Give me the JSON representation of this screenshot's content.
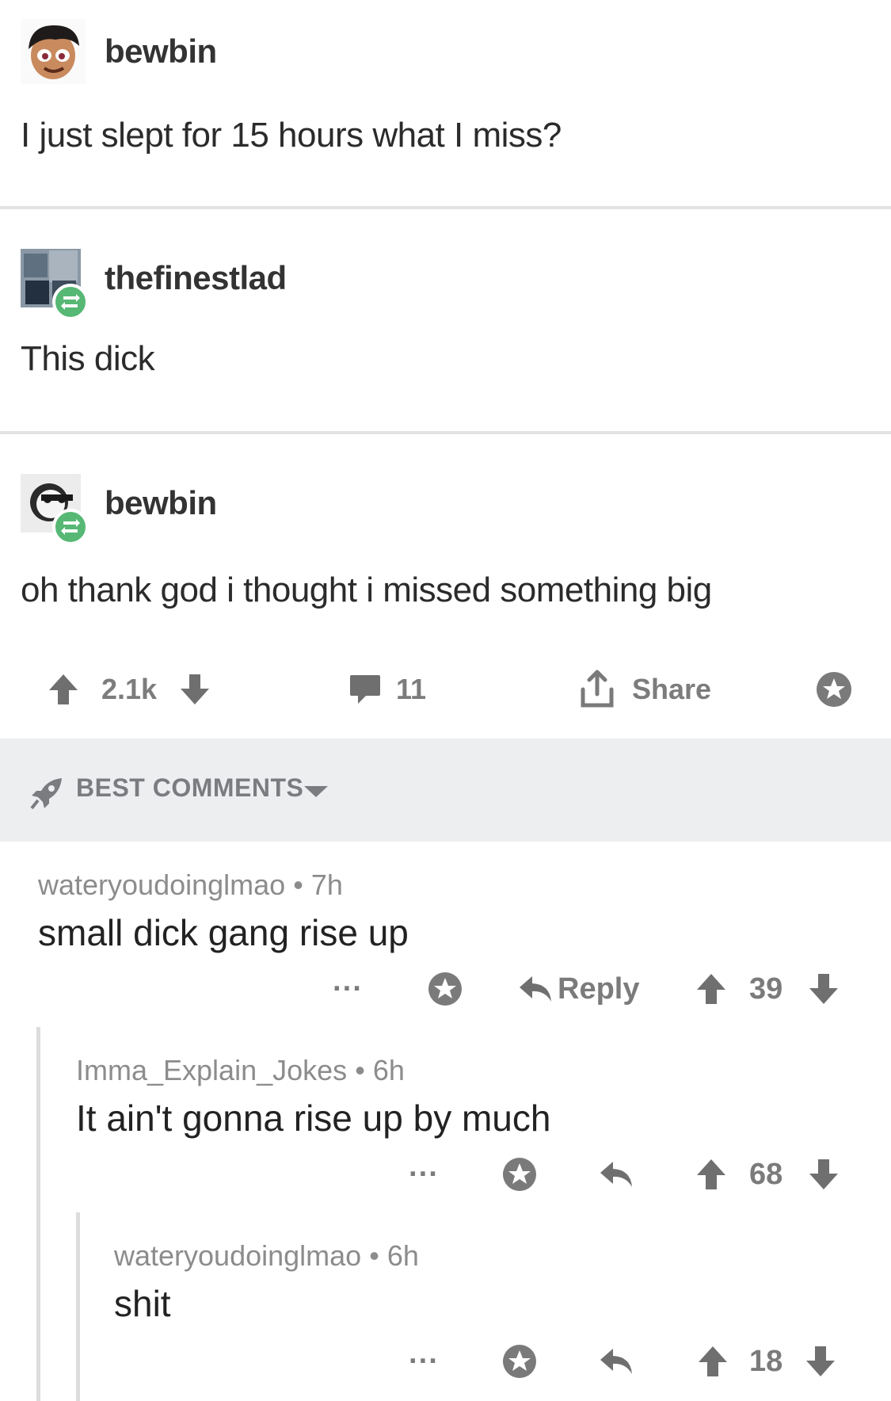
{
  "posts": [
    {
      "username": "bewbin",
      "text": "I just slept for 15 hours what I miss?"
    },
    {
      "username": "thefinestlad",
      "text": "This dick"
    },
    {
      "username": "bewbin",
      "text": "oh thank god i thought i missed something big"
    }
  ],
  "actions": {
    "upvotes": "2.1k",
    "comments": "11",
    "share_label": "Share"
  },
  "comments_header": {
    "label": "BEST COMMENTS"
  },
  "comments": [
    {
      "author": "wateryoudoinglmao",
      "sep": "•",
      "age": "7h",
      "body": "small dick gang rise up",
      "reply_label": "Reply",
      "score": "39",
      "more": "···"
    },
    {
      "author": "Imma_Explain_Jokes",
      "sep": "•",
      "age": "6h",
      "body": "It ain't gonna rise up by much",
      "score": "68",
      "more": "···"
    },
    {
      "author": "wateryoudoinglmao",
      "sep": "•",
      "age": "6h",
      "body": "shit",
      "score": "18",
      "more": "···"
    }
  ],
  "icons": {
    "upvote": "arrow-up-icon",
    "downvote": "arrow-down-icon",
    "comment": "speech-bubble-icon",
    "share": "share-icon",
    "save": "star-icon",
    "reply": "reply-arrow-icon",
    "sort": "rocket-icon",
    "reblog": "reblog-icon"
  },
  "colors": {
    "reblog_green": "#56b874",
    "header_gray": "#edeef0",
    "muted_text": "#7b7b7b"
  }
}
